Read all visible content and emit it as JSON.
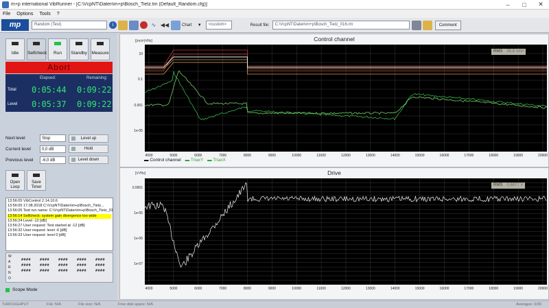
{
  "window": {
    "title": "m+p international VibRunner - [C:\\VcpNT\\Daten\\m+p\\Bosch_Tietz.tm   (Default_Random.cfg)]"
  },
  "menu": [
    "File",
    "Options",
    "Tools",
    "?"
  ],
  "toolbar": {
    "logo": "mp",
    "test_combo": "Random (Test)",
    "chart_label": "Chart",
    "custom_combo": "<custom>",
    "result_label": "Result file:",
    "result_path": "C:\\VcpNT\\Daten\\m+p\\Bosch_Tietz_016.rm",
    "comment_label": "Comment"
  },
  "modes": [
    "Idle",
    "Selfcheck",
    "Run",
    "Standby",
    "Measure"
  ],
  "abort_label": "Abort",
  "time": {
    "elapsed_header": "Elapsed:",
    "remaining_header": "Remaining:",
    "total_label": "Total",
    "level_label": "Level",
    "total_elapsed": "0:05:44",
    "total_remaining": "0:09:22",
    "level_elapsed": "0:05:37",
    "level_remaining": "0:09:22"
  },
  "levels": {
    "next_label": "Next level",
    "next_value": "Stop",
    "current_label": "Current level",
    "current_value": "0,0 dB",
    "previous_label": "Previous level",
    "previous_value": "-6,0 dB",
    "up_button": "Level up",
    "hold_button": "Hold",
    "down_button": "Level down"
  },
  "loop_buttons": [
    "Open Loop",
    "Save Timer"
  ],
  "log": [
    {
      "time": "13:56:05",
      "text": "VibControl 2.14.10.6",
      "hl": false
    },
    {
      "time": "13:56:05",
      "text": "17.08.2018 C:\\VcpNT\\Daten\\m+p\\Bosch_Tietz...",
      "hl": false
    },
    {
      "time": "13:56:05",
      "text": "Test run name: C:\\VcpNT\\Daten\\m+p\\Bosch_Tietz_016.rm",
      "hl": false
    },
    {
      "time": "13:56:14",
      "text": "Selfcheck: system gain divergence too wide",
      "hl": true
    },
    {
      "time": "13:56:24",
      "text": "Level                          -12 [dB]",
      "hl": false
    },
    {
      "time": "13:56:27",
      "text": "User request: Test started at   -12 [dB]",
      "hl": false
    },
    {
      "time": "13:56:32",
      "text": "User request: level             -6 [dB]",
      "hl": false
    },
    {
      "time": "13:56:33",
      "text": "User request: level              0 [dB]",
      "hl": false
    }
  ],
  "warno_letters": [
    "W",
    "A",
    "R",
    "N",
    "O"
  ],
  "scope_mode_label": "Scope Mode",
  "control_chart": {
    "title": "Control channel",
    "unit": "[(m/s²)²/Hz]",
    "rms_label": "RMS",
    "rms_value": "35,8 m/s²",
    "y_ticks": [
      "10",
      "0.1",
      "0.001",
      "1e-05"
    ],
    "x_ticks": [
      "4000",
      "5000",
      "6000",
      "7000",
      "8000",
      "9000",
      "10000",
      "11000",
      "12000",
      "13000",
      "14000",
      "15000",
      "16000",
      "17000",
      "18000",
      "19000",
      "20000"
    ],
    "legend": [
      "Control channel",
      "TriaxY",
      "TriaxX"
    ]
  },
  "drive_chart": {
    "title": "Drive",
    "unit": "[V²/Hz]",
    "rms_label": "RMS",
    "rms_value": "0,6877 V",
    "y_ticks": [
      "0.0001",
      "1e-05",
      "1e-06",
      "1e-07"
    ],
    "x_ticks": [
      "4000",
      "5000",
      "6000",
      "7000",
      "8000",
      "9000",
      "10000",
      "11000",
      "12000",
      "13000",
      "14000",
      "15000",
      "16000",
      "17000",
      "18000",
      "19000",
      "20000"
    ]
  },
  "status": {
    "throughput": "THROUGHPUT",
    "file": "File: N/A",
    "file_size": "File size: N/A",
    "disk": "Free disk space: N/A",
    "averages": "Averages: 0/30"
  },
  "colors": {
    "abort": "#e21515",
    "timebox": "#1c2f63",
    "time_digits": "#30e870",
    "log_highlight": "#ffff00",
    "plot_bg": "#000000"
  }
}
